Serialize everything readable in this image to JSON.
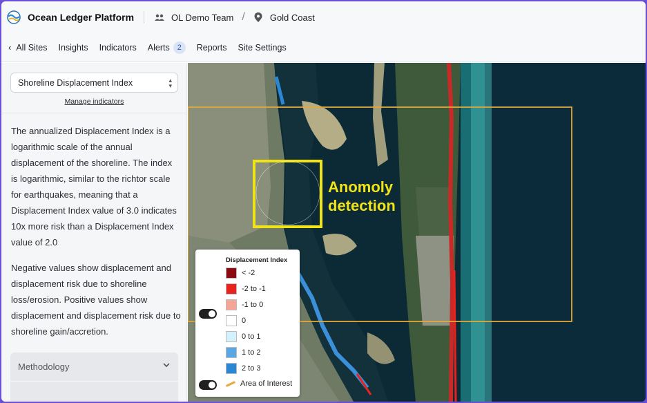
{
  "header": {
    "app_title": "Ocean Ledger Platform",
    "team": "OL Demo Team",
    "site": "Gold Coast",
    "logo_icon": "ocean-wave-logo",
    "team_icon": "people-icon",
    "site_icon": "map-pin-icon"
  },
  "nav": {
    "back_label": "All Sites",
    "items": [
      {
        "label": "Insights"
      },
      {
        "label": "Indicators"
      },
      {
        "label": "Alerts",
        "badge": "2"
      },
      {
        "label": "Reports"
      },
      {
        "label": "Site Settings"
      }
    ]
  },
  "sidebar": {
    "selected_indicator": "Shoreline Displacement Index",
    "manage_link": "Manage indicators",
    "description_1": "The annualized Displacement Index is a logarithmic scale of the annual displacement of the shoreline. The index is logarithmic, similar to the richtor scale for earthquakes, meaning that a Displacement Index value of 3.0 indicates 10x more risk than a Displacement Index value of 2.0",
    "description_2": "Negative values show displacement and displacement risk due to shoreline loss/erosion. Positive values show displacement and displacement risk due to shoreline gain/accretion.",
    "accordion_label": "Methodology"
  },
  "map": {
    "callout": "Anomoly detection",
    "legend": {
      "title": "Displacement Index",
      "items": [
        {
          "label": "< -2",
          "color": "#8b0a10"
        },
        {
          "label": "-2 to -1",
          "color": "#e8231f"
        },
        {
          "label": "-1 to 0",
          "color": "#f4a596"
        },
        {
          "label": "0",
          "color": "#ffffff"
        },
        {
          "label": "0 to 1",
          "color": "#d5f1fb"
        },
        {
          "label": "1 to 2",
          "color": "#5aa7e3"
        },
        {
          "label": "2 to 3",
          "color": "#2b86d3"
        }
      ],
      "aoi_label": "Area of Interest",
      "aoi_color": "#e8a93a"
    }
  }
}
